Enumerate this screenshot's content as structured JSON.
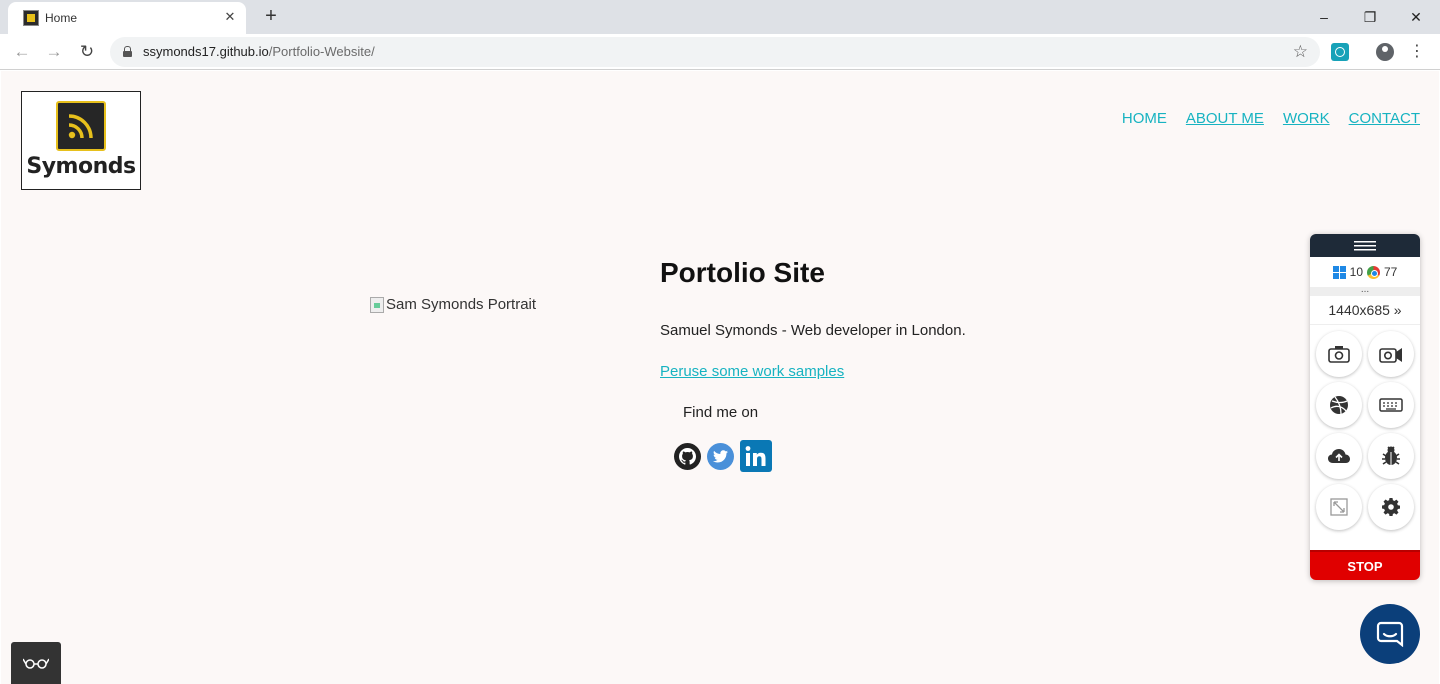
{
  "browser": {
    "tab_title": "Home",
    "tab_close": "✕",
    "new_tab": "+",
    "window_controls": {
      "minimize": "–",
      "restore": "❐",
      "close": "✕"
    },
    "url_host": "ssymonds17.github.io",
    "url_path": "/Portfolio-Website/",
    "back": "←",
    "forward": "→",
    "reload": "↻",
    "star": "☆",
    "menu": "⋮"
  },
  "site": {
    "logo_text": "Symonds",
    "nav": [
      {
        "label": "HOME"
      },
      {
        "label": "ABOUT ME"
      },
      {
        "label": "WORK"
      },
      {
        "label": "CONTACT"
      }
    ],
    "portrait_alt": "Sam Symonds Portrait",
    "title": "Portolio Site",
    "subtitle": "Samuel Symonds - Web developer in London.",
    "work_link": "Peruse some work samples",
    "find_me": "Find me on",
    "social": [
      "github-icon",
      "twitter-icon",
      "linkedin-icon"
    ]
  },
  "widget": {
    "os_version": "10",
    "browser_version": "77",
    "dots": "...",
    "resolution": "1440x685",
    "resolution_arrow": "»",
    "stop_label": "STOP",
    "buttons": [
      "screenshot-icon",
      "video-icon",
      "dribbble-icon",
      "keyboard-icon",
      "upload-icon",
      "bug-icon",
      "resize-icon",
      "settings-icon"
    ]
  },
  "colors": {
    "accent": "#17b3c1",
    "page_bg": "#fcf8f7",
    "stop": "#e00000",
    "chat": "#0b3f7a"
  }
}
